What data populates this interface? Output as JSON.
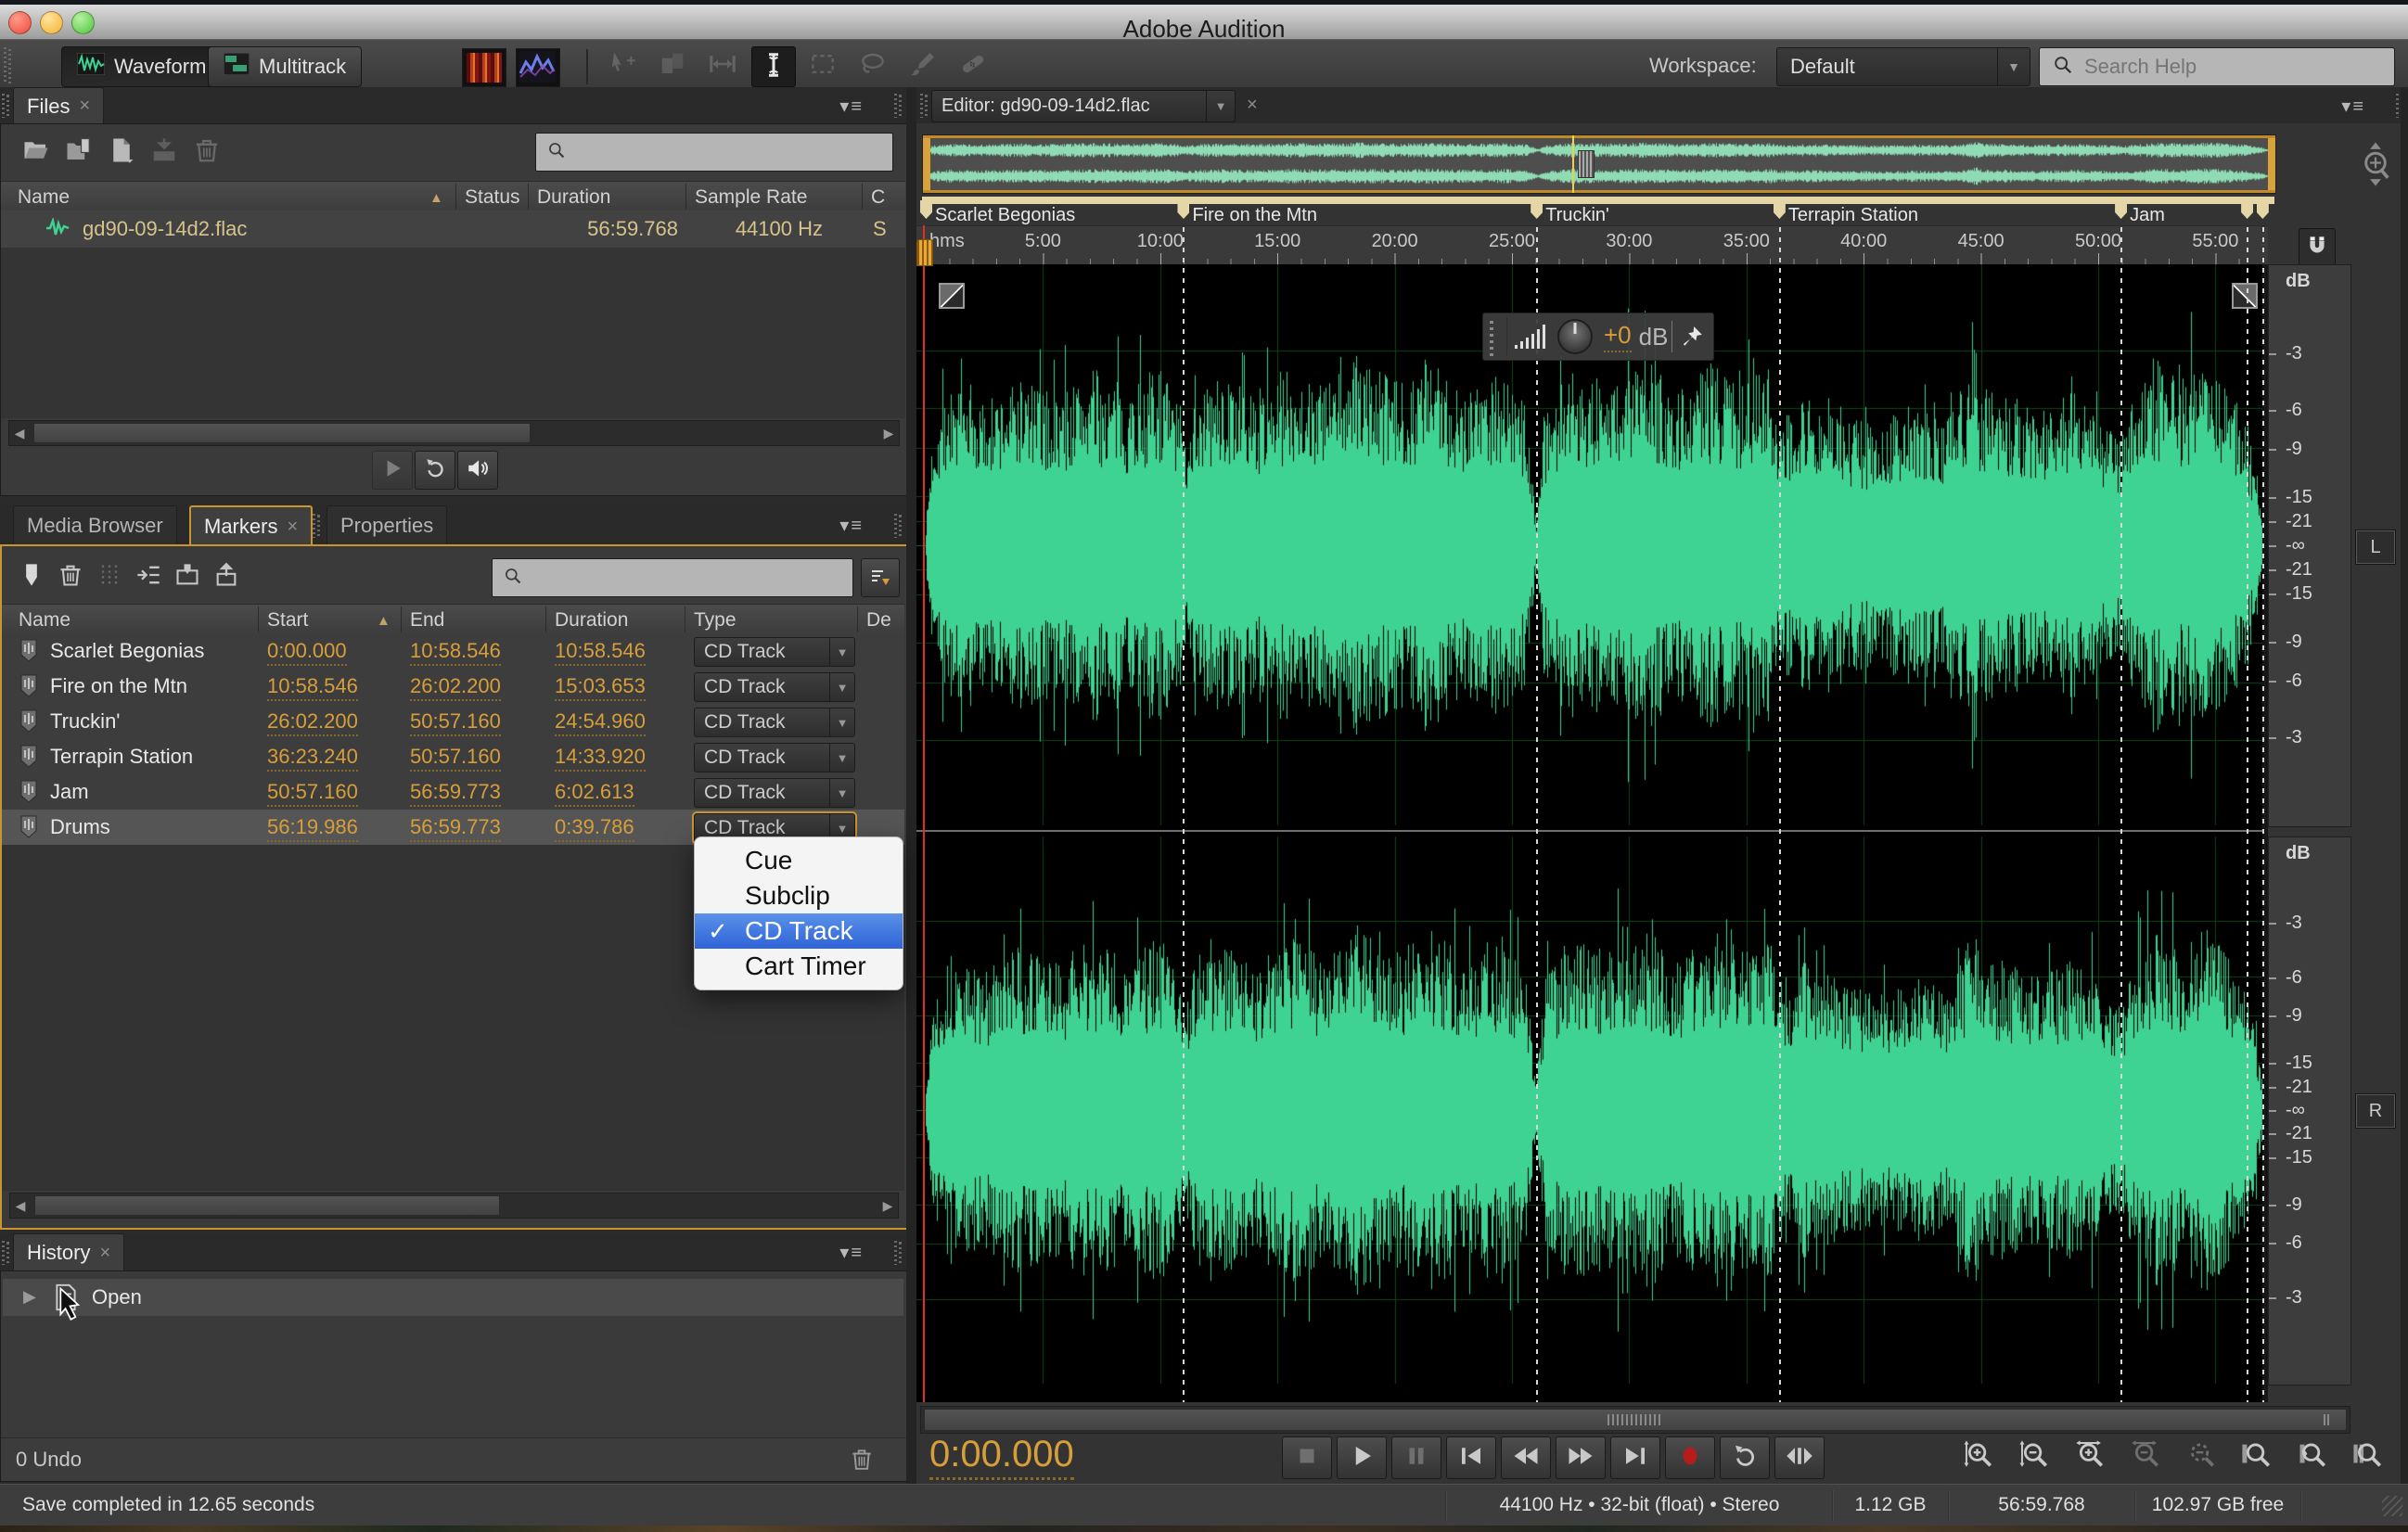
{
  "window": {
    "title": "Adobe Audition"
  },
  "toolbar": {
    "waveform": "Waveform",
    "multitrack": "Multitrack",
    "workspace_label": "Workspace:",
    "workspace_value": "Default",
    "help_search_placeholder": "Search Help",
    "tools": [
      "spectral-frequency-display",
      "spectral-pitch-display",
      "move-tool",
      "slip-tool",
      "time-selection-arrows",
      "time-selection-ibeam",
      "marquee-selection",
      "lasso-selection",
      "paintbrush-selection",
      "spot-healing-brush"
    ],
    "active_tool": "time-selection-ibeam"
  },
  "files_panel": {
    "tab_label": "Files",
    "search_placeholder": "",
    "columns": [
      "Name",
      "Status",
      "Duration",
      "Sample Rate",
      "C"
    ],
    "toolbar_icons": [
      "open-file",
      "import-file",
      "new-file",
      "insert-into-multitrack",
      "trash"
    ],
    "rows": [
      {
        "name": "gd90-09-14d2.flac",
        "status": "",
        "duration": "56:59.768",
        "sample_rate": "44100 Hz",
        "channels": "S"
      }
    ],
    "footer_icons": [
      "play",
      "loop-playback",
      "auto-play-volume"
    ]
  },
  "markers_panel": {
    "tabs": [
      "Media Browser",
      "Markers",
      "Properties"
    ],
    "active_tab": "Markers",
    "search_placeholder": "",
    "toolbar_icons": [
      "add-marker",
      "delete-marker",
      "merge-markers",
      "insert-into-playlist",
      "make-range-marker",
      "export-markers"
    ],
    "columns": [
      "Name",
      "Start",
      "End",
      "Duration",
      "Type",
      "De"
    ],
    "rows": [
      {
        "name": "Scarlet Begonias",
        "start": "0:00.000",
        "end": "10:58.546",
        "duration": "10:58.546",
        "type": "CD Track"
      },
      {
        "name": "Fire on the Mtn",
        "start": "10:58.546",
        "end": "26:02.200",
        "duration": "15:03.653",
        "type": "CD Track"
      },
      {
        "name": "Truckin'",
        "start": "26:02.200",
        "end": "50:57.160",
        "duration": "24:54.960",
        "type": "CD Track"
      },
      {
        "name": "Terrapin Station",
        "start": "36:23.240",
        "end": "50:57.160",
        "duration": "14:33.920",
        "type": "CD Track"
      },
      {
        "name": "Jam",
        "start": "50:57.160",
        "end": "56:59.773",
        "duration": "6:02.613",
        "type": "CD Track"
      },
      {
        "name": "Drums",
        "start": "56:19.986",
        "end": "56:59.773",
        "duration": "0:39.786",
        "type": "CD Track"
      }
    ],
    "selected_row": "Drums"
  },
  "type_dropdown": {
    "items": [
      {
        "label": "Cue",
        "checked": false
      },
      {
        "label": "Subclip",
        "checked": false
      },
      {
        "label": "CD Track",
        "checked": true
      },
      {
        "label": "Cart Timer",
        "checked": false
      }
    ]
  },
  "history_panel": {
    "tab_label": "History",
    "entries": [
      {
        "label": "Open"
      }
    ],
    "footer": "0 Undo"
  },
  "editor": {
    "tab_label": "Editor: gd90-09-14d2.flac",
    "ruler_unit": "hms",
    "ruler_ticks": [
      {
        "label": "5:00",
        "min": 5
      },
      {
        "label": "10:00",
        "min": 10
      },
      {
        "label": "15:00",
        "min": 15
      },
      {
        "label": "20:00",
        "min": 20
      },
      {
        "label": "25:00",
        "min": 25
      },
      {
        "label": "30:00",
        "min": 30
      },
      {
        "label": "35:00",
        "min": 35
      },
      {
        "label": "40:00",
        "min": 40
      },
      {
        "label": "45:00",
        "min": 45
      },
      {
        "label": "50:00",
        "min": 50
      },
      {
        "label": "55:00",
        "min": 55
      }
    ],
    "sections": [
      {
        "label": "Scarlet Begonias",
        "start_min": 0
      },
      {
        "label": "Fire on the Mtn",
        "start_min": 10.976
      },
      {
        "label": "Truckin'",
        "start_min": 26.037
      },
      {
        "label": "Terrapin Station",
        "start_min": 36.387
      },
      {
        "label": "Jam",
        "start_min": 50.953
      }
    ],
    "flag_times_min": [
      0,
      10.976,
      26.037,
      36.387,
      50.953,
      56.333,
      56.996
    ],
    "marker_line_times_min": [
      10.976,
      26.037,
      36.387,
      50.953,
      56.333,
      56.996
    ],
    "eof_min": 56.996,
    "hud": {
      "gain": "+0",
      "unit": "dB"
    },
    "db_scale": {
      "unit": "dB",
      "ticks": [
        {
          "label": "-3",
          "frac": 0.708
        },
        {
          "label": "-6",
          "frac": 0.501
        },
        {
          "label": "-9",
          "frac": 0.355
        },
        {
          "label": "-15",
          "frac": 0.178
        },
        {
          "label": "-21",
          "frac": 0.089
        },
        {
          "label": "-∞",
          "frac": 0
        }
      ],
      "left_channel": "L",
      "right_channel": "R"
    },
    "waveform": {
      "color": "#3ed392",
      "grid_color": "#0d4418",
      "envelope": [
        [
          0,
          0.08
        ],
        [
          0.3,
          0.45
        ],
        [
          1,
          0.58
        ],
        [
          2.5,
          0.52
        ],
        [
          4,
          0.62
        ],
        [
          5.5,
          0.55
        ],
        [
          7,
          0.65
        ],
        [
          8.5,
          0.58
        ],
        [
          10,
          0.66
        ],
        [
          10.9,
          0.5
        ],
        [
          11.05,
          0.38
        ],
        [
          11.3,
          0.55
        ],
        [
          12.5,
          0.62
        ],
        [
          14,
          0.56
        ],
        [
          15.5,
          0.66
        ],
        [
          17,
          0.6
        ],
        [
          18.5,
          0.7
        ],
        [
          20,
          0.6
        ],
        [
          21.5,
          0.68
        ],
        [
          23,
          0.58
        ],
        [
          24.5,
          0.66
        ],
        [
          25.6,
          0.5
        ],
        [
          26.02,
          0.1
        ],
        [
          26.4,
          0.5
        ],
        [
          27.5,
          0.66
        ],
        [
          29,
          0.6
        ],
        [
          30.5,
          0.68
        ],
        [
          32,
          0.58
        ],
        [
          33.5,
          0.66
        ],
        [
          35,
          0.6
        ],
        [
          35.9,
          0.66
        ],
        [
          36.4,
          0.5
        ],
        [
          37.5,
          0.56
        ],
        [
          39,
          0.48
        ],
        [
          40.5,
          0.44
        ],
        [
          42,
          0.5
        ],
        [
          43.5,
          0.46
        ],
        [
          44.4,
          0.62
        ],
        [
          44.65,
          0.92
        ],
        [
          44.9,
          0.6
        ],
        [
          46,
          0.56
        ],
        [
          47.5,
          0.5
        ],
        [
          49,
          0.58
        ],
        [
          50.3,
          0.46
        ],
        [
          50.95,
          0.4
        ],
        [
          51.6,
          0.58
        ],
        [
          52.5,
          0.68
        ],
        [
          53.5,
          0.6
        ],
        [
          54.3,
          0.72
        ],
        [
          55.2,
          0.62
        ],
        [
          56.1,
          0.5
        ],
        [
          56.35,
          0.42
        ],
        [
          56.7,
          0.3
        ],
        [
          56.99,
          0.1
        ]
      ]
    }
  },
  "transport": {
    "time_display": "0:00.000",
    "buttons": [
      {
        "name": "stop",
        "disabled": true
      },
      {
        "name": "play",
        "disabled": false
      },
      {
        "name": "pause",
        "disabled": true
      },
      {
        "name": "go-to-previous",
        "disabled": false
      },
      {
        "name": "rewind",
        "disabled": false
      },
      {
        "name": "fast-forward",
        "disabled": false
      },
      {
        "name": "go-to-next",
        "disabled": false
      },
      {
        "name": "record",
        "disabled": false
      },
      {
        "name": "loop-playback",
        "disabled": false
      },
      {
        "name": "skip-selection",
        "disabled": false
      }
    ]
  },
  "zoom_bar": {
    "buttons": [
      {
        "name": "zoom-in-vertical",
        "disabled": false
      },
      {
        "name": "zoom-out-vertical",
        "disabled": false
      },
      {
        "name": "zoom-in-horizontal",
        "disabled": false
      },
      {
        "name": "zoom-out-horizontal",
        "disabled": true
      },
      {
        "name": "zoom-out-full",
        "disabled": true
      },
      {
        "name": "zoom-in-at-in-point",
        "disabled": false
      },
      {
        "name": "zoom-in-at-out-point",
        "disabled": false
      },
      {
        "name": "zoom-to-selection",
        "disabled": false
      }
    ]
  },
  "status_bar": {
    "message": "Save completed in 12.65 seconds",
    "format": "44100 Hz • 32-bit (float) • Stereo",
    "file_size": "1.12 GB",
    "duration": "56:59.768",
    "free_space": "102.97 GB free"
  },
  "colors": {
    "accent_amber": "#d79e3a",
    "waveform_green": "#3ed392",
    "selection_blue": "#3b77d8",
    "record_red": "#b51d1d",
    "focus_orange": "#c9952f"
  }
}
